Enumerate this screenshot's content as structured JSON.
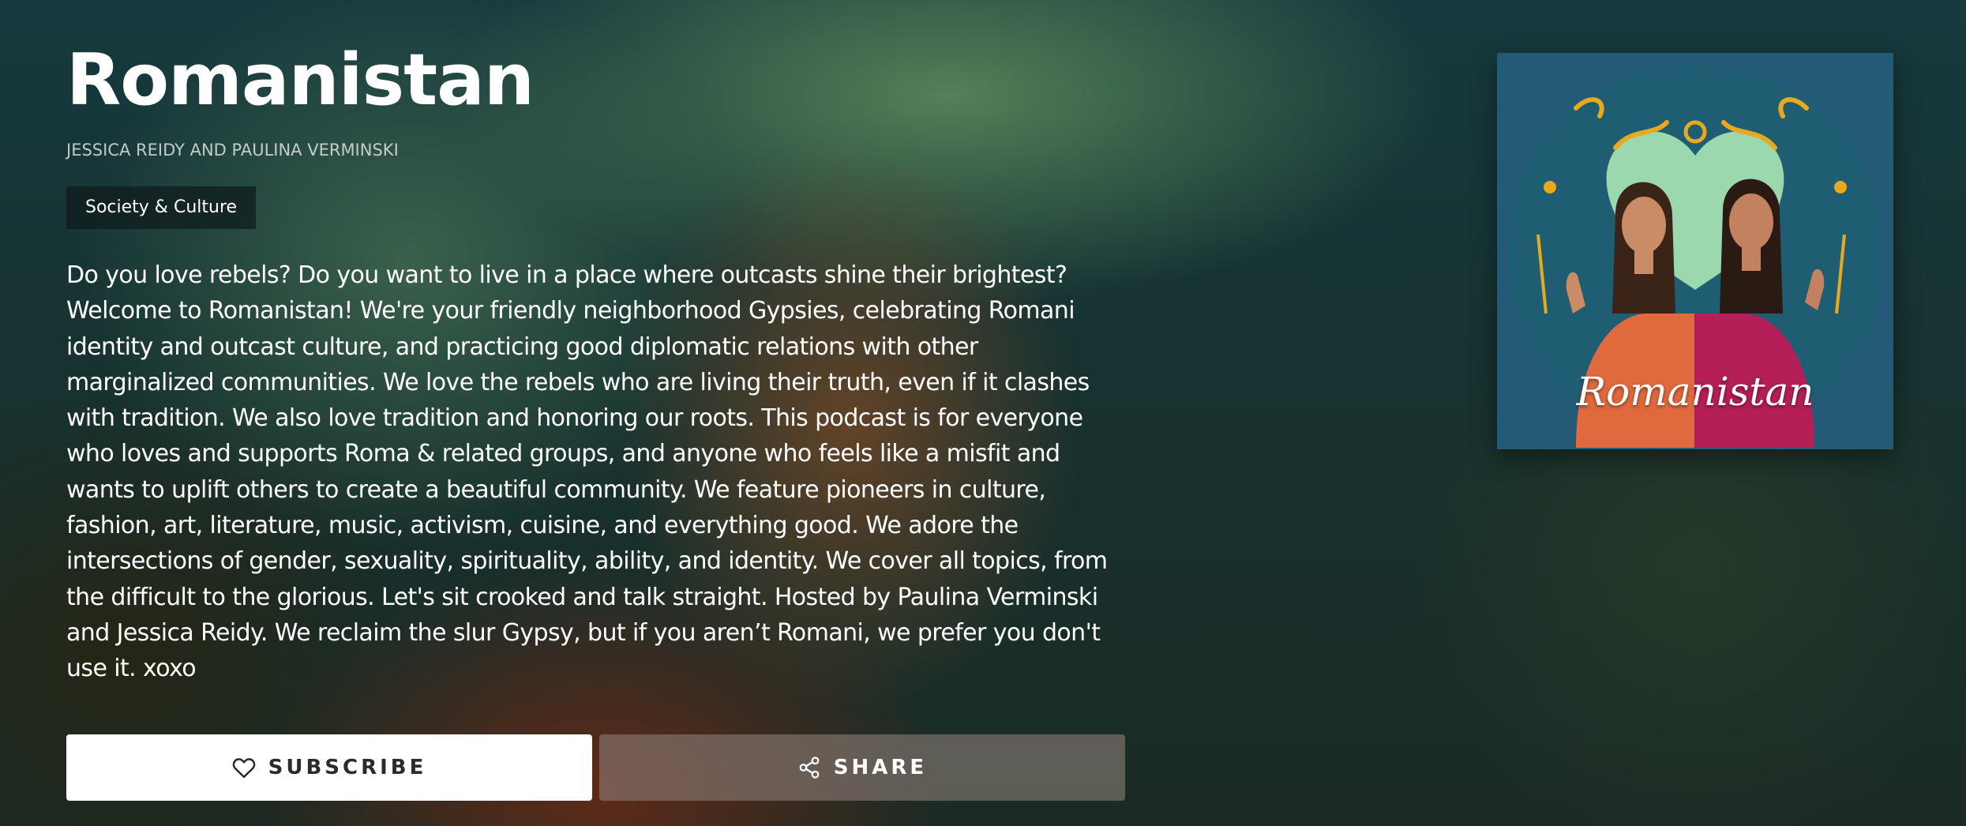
{
  "podcast": {
    "title": "Romanistan",
    "authors": "JESSICA REIDY AND PAULINA VERMINSKI",
    "category": "Society & Culture",
    "description": "Do you love rebels? Do you want to live in a place where outcasts shine their brightest? Welcome to Romanistan! We're your friendly neighborhood Gypsies, celebrating Romani identity and outcast culture, and practicing good diplomatic relations with other marginalized communities. We love the rebels who are living their truth, even if it clashes with tradition. We also love tradition and honoring our roots. This podcast is for everyone who loves and supports Roma & related groups, and anyone who feels like a misfit and wants to uplift others to create a beautiful community. We feature pioneers in culture, fashion, art, literature, music, activism, cuisine, and everything good. We adore the intersections of gender, sexuality, spirituality, ability, and identity. We cover all topics, from the difficult to the glorious. Let's sit crooked and talk straight. Hosted by Paulina Verminski and Jessica Reidy. We reclaim the slur Gypsy, but if you aren’t Romani, we prefer you don't use it. xoxo"
  },
  "actions": {
    "subscribe_label": "SUBSCRIBE",
    "share_label": "SHARE",
    "subscribe_icon": "heart-outline-icon",
    "share_icon": "share-nodes-icon"
  },
  "cover_art": {
    "wordmark": "Romanistan",
    "accent_gold": "#e8a91e",
    "background_blue": "#2a6a86",
    "circle_teal": "#1f5e72",
    "heart_green": "#a8e6b4"
  }
}
